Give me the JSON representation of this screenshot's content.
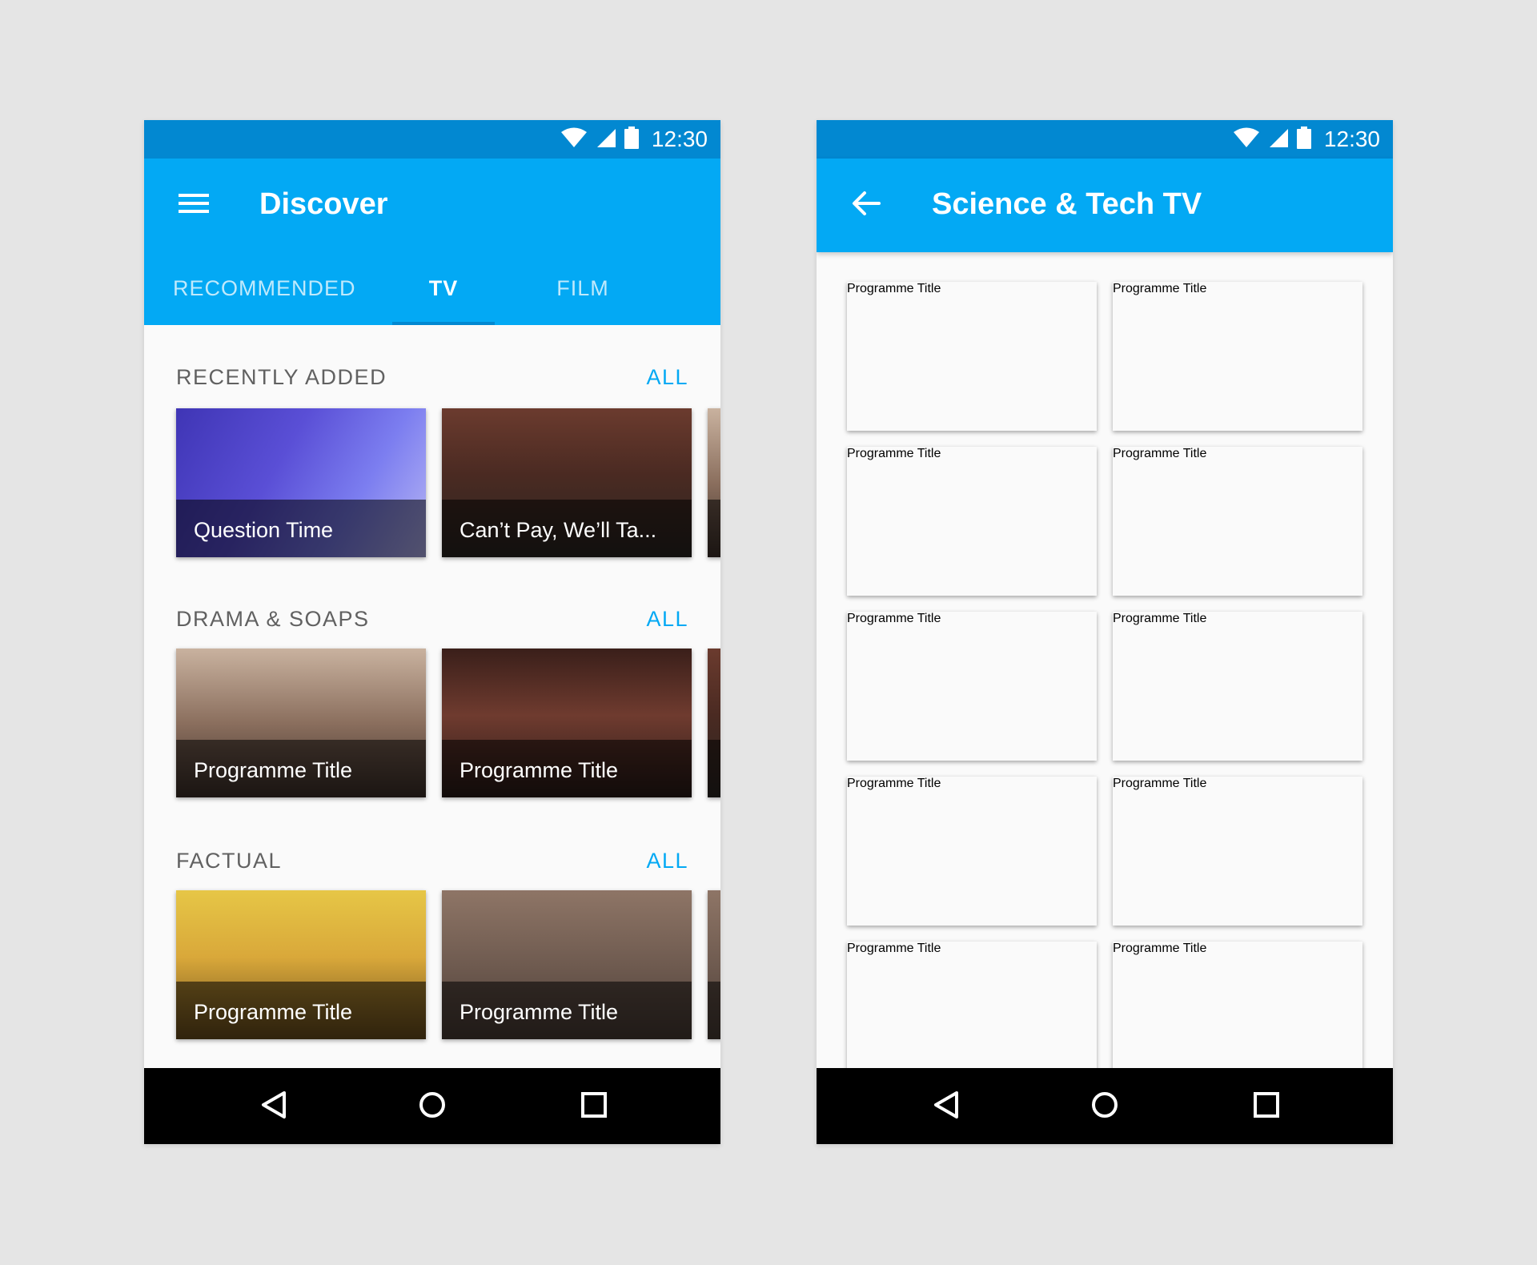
{
  "left": {
    "status": {
      "time": "12:30"
    },
    "app_bar": {
      "title": "Discover"
    },
    "tabs": [
      {
        "label": "RECOMMENDED"
      },
      {
        "label": "TV"
      },
      {
        "label": "FILM"
      }
    ],
    "sections": [
      {
        "title": "RECENTLY ADDED",
        "all_label": "ALL",
        "cards": [
          {
            "title": "Question Time"
          },
          {
            "title": "Can’t Pay, We’ll Ta..."
          }
        ]
      },
      {
        "title": "DRAMA & SOAPS",
        "all_label": "ALL",
        "cards": [
          {
            "title": "Programme Title"
          },
          {
            "title": "Programme Title"
          }
        ]
      },
      {
        "title": "FACTUAL",
        "all_label": "ALL",
        "cards": [
          {
            "title": "Programme Title"
          },
          {
            "title": "Programme Title"
          }
        ]
      }
    ]
  },
  "right": {
    "status": {
      "time": "12:30"
    },
    "app_bar": {
      "title": "Science & Tech TV"
    },
    "grid": [
      {
        "title": "Programme Title"
      },
      {
        "title": "Programme Title"
      },
      {
        "title": "Programme Title"
      },
      {
        "title": "Programme Title"
      },
      {
        "title": "Programme Title"
      },
      {
        "title": "Programme Title"
      },
      {
        "title": "Programme Title"
      },
      {
        "title": "Programme Title"
      },
      {
        "title": "Programme Title"
      },
      {
        "title": "Programme Title"
      }
    ]
  },
  "colors": {
    "status_bar": "#0288d1",
    "app_bar": "#03a9f4",
    "accent": "#03a9f4",
    "nav_bar": "#000000",
    "background": "#fafafa"
  },
  "icons": [
    "wifi-icon",
    "cell-signal-icon",
    "battery-icon",
    "menu-icon",
    "back-arrow-icon",
    "nav-back-icon",
    "nav-home-icon",
    "nav-recents-icon"
  ]
}
